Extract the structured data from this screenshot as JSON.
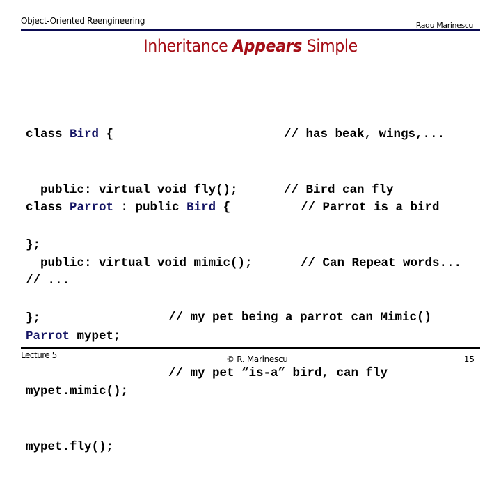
{
  "header": {
    "course": "Object-Oriented Reengineering",
    "author": "Radu Marinescu",
    "line_color": "#0a0a50"
  },
  "title": {
    "before": "Inheritance ",
    "emphasis": "Appears",
    "after": " Simple",
    "color": "#a50f17"
  },
  "code": {
    "block1": {
      "lines": [
        {
          "pre": "class ",
          "type": "Bird",
          "post": " {"
        },
        {
          "text": "  public: virtual void fly();"
        },
        {
          "text": "};"
        }
      ],
      "comments": [
        "// has beak, wings,...",
        "// Bird can fly"
      ]
    },
    "block2": {
      "lines": [
        {
          "pre": "class ",
          "type": "Parrot",
          "mid": " : public ",
          "type2": "Bird",
          "post": " {"
        },
        {
          "text": "  public: virtual void mimic();"
        },
        {
          "text": "};"
        }
      ],
      "comments": [
        "// Parrot is a bird",
        "// Can Repeat words..."
      ]
    },
    "block3": {
      "lines": [
        {
          "text": "// ..."
        },
        {
          "type": "Parrot",
          "post": " mypet;"
        },
        {
          "text": "mypet.mimic();"
        },
        {
          "text": "mypet.fly();"
        }
      ],
      "comments": [
        "// my pet being a parrot can Mimic()",
        "// my pet “is-a” bird, can fly"
      ]
    },
    "type_color": "#141464"
  },
  "footer": {
    "lecture": "Lecture 5",
    "copyright": "© R. Marinescu",
    "page_number": "15"
  }
}
